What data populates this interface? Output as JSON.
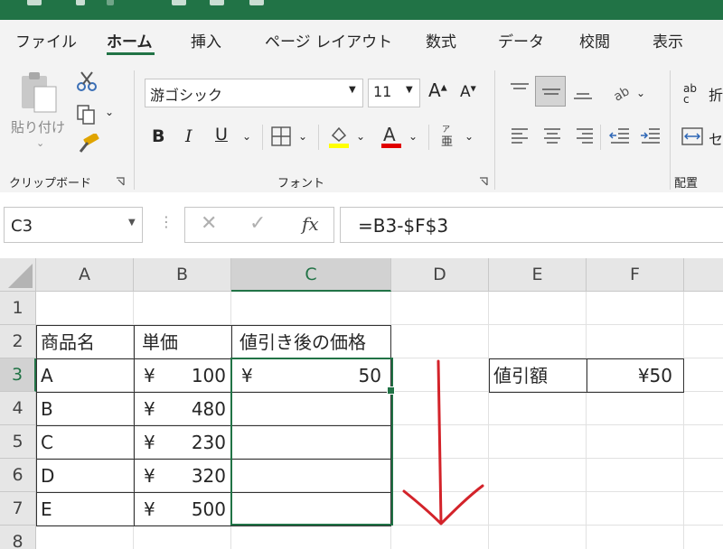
{
  "ribbon": {
    "tabs": [
      {
        "label": "ファイル"
      },
      {
        "label": "ホーム"
      },
      {
        "label": "挿入"
      },
      {
        "label": "ページ レイアウト"
      },
      {
        "label": "数式"
      },
      {
        "label": "データ"
      },
      {
        "label": "校閲"
      },
      {
        "label": "表示"
      }
    ],
    "clipboard": {
      "paste_label": "貼り付け",
      "group_label": "クリップボード"
    },
    "font": {
      "family": "游ゴシック",
      "size": "11",
      "bold": "B",
      "italic": "I",
      "underline": "U",
      "group_label": "フォント"
    },
    "alignment": {
      "group_label": "配置",
      "wrap_label": "折",
      "merge_label": "セ"
    }
  },
  "formula_bar": {
    "name_box": "C3",
    "fx": "fx",
    "formula": "=B3-$F$3"
  },
  "sheet": {
    "columns": [
      "A",
      "B",
      "C",
      "D",
      "E",
      "F"
    ],
    "rows": [
      "1",
      "2",
      "3",
      "4",
      "5",
      "6",
      "7",
      "8"
    ],
    "headers": {
      "product": "商品名",
      "price": "単価",
      "discounted": "値引き後の価格"
    },
    "currency_symbol": "¥",
    "items": [
      {
        "name": "A",
        "price": "100"
      },
      {
        "name": "B",
        "price": "480"
      },
      {
        "name": "C",
        "price": "230"
      },
      {
        "name": "D",
        "price": "320"
      },
      {
        "name": "E",
        "price": "500"
      }
    ],
    "c3_value": "50",
    "discount_label": "値引額",
    "discount_value": "¥50"
  },
  "colors": {
    "accent": "#217346",
    "arrow": "#d3232a"
  }
}
